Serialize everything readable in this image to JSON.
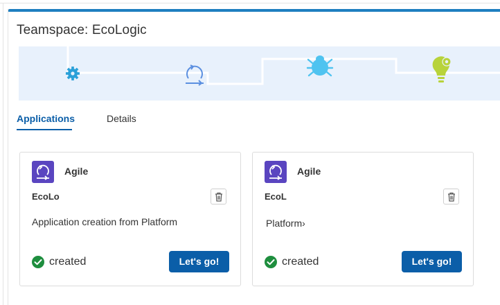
{
  "page": {
    "title": "Teamspace: EcoLogic"
  },
  "banner": {
    "icons": [
      "gear-icon",
      "cycle-icon",
      "bug-icon",
      "idea-gear-icon"
    ],
    "colors": {
      "background": "#e8f1fc",
      "path": "#ffffff",
      "gear": "#2aa0d8",
      "cycle": "#5b8fe0",
      "bug": "#4fc3f0",
      "idea": "#b8d33a"
    }
  },
  "tabs": [
    {
      "label": "Applications",
      "active": true
    },
    {
      "label": "Details",
      "active": false
    }
  ],
  "cards": [
    {
      "type": "Agile",
      "name": "EcoLo",
      "description": "Application creation from Platform",
      "status": "created",
      "action": "Let's go!",
      "icon": "agile-cycle-icon"
    },
    {
      "type": "Agile",
      "name": "EcoL",
      "description": "Platform›",
      "status": "created",
      "action": "Let's go!",
      "icon": "agile-cycle-icon"
    }
  ],
  "colors": {
    "accent": "#0b5ea8",
    "topbar": "#1e7fc0",
    "app_icon_bg": "#5a45c0",
    "status_ok": "#1e8e3e"
  }
}
